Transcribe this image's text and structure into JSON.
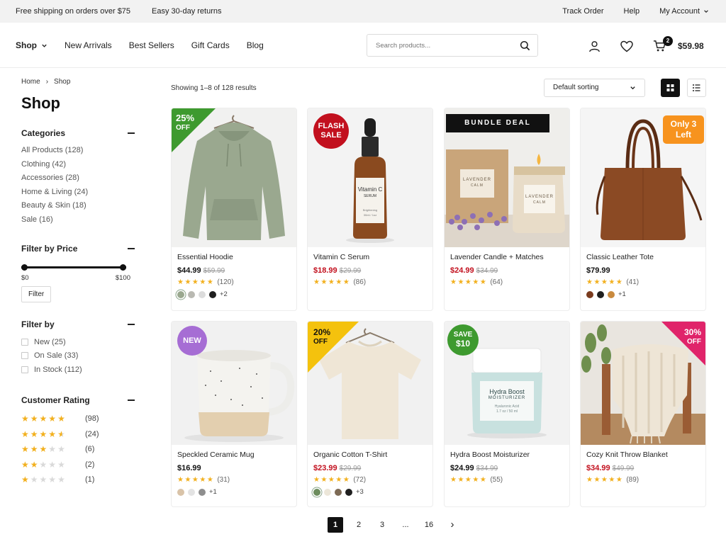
{
  "topbar": {
    "promo1": "Free shipping on orders over $75",
    "promo2": "Easy 30-day returns",
    "track": "Track Order",
    "help": "Help",
    "account": "My Account"
  },
  "nav": {
    "shop": "Shop",
    "items": [
      "New Arrivals",
      "Best Sellers",
      "Gift Cards",
      "Blog"
    ]
  },
  "search": {
    "placeholder": "Search products..."
  },
  "cart": {
    "count": "2",
    "total": "$59.98"
  },
  "breadcrumb": {
    "home": "Home",
    "sep": "›",
    "current": "Shop"
  },
  "page_title": "Shop",
  "categories": {
    "title": "Categories",
    "items": [
      "All Products (128)",
      "Clothing (42)",
      "Accessories (28)",
      "Home & Living (24)",
      "Beauty & Skin (18)",
      "Sale (16)"
    ]
  },
  "price_filter": {
    "title": "Filter by Price",
    "min": "$0",
    "max": "$100",
    "button": "Filter",
    "low_fraction": 0,
    "high_fraction": 1
  },
  "filter_by": {
    "title": "Filter by",
    "items": [
      "New (25)",
      "On Sale (33)",
      "In Stock (112)"
    ]
  },
  "customer_rating": {
    "title": "Customer Rating",
    "rows": [
      {
        "stars": 5,
        "count": "(98)"
      },
      {
        "stars": 4.5,
        "count": "(24)"
      },
      {
        "stars": 3,
        "count": "(6)"
      },
      {
        "stars": 2,
        "count": "(2)"
      },
      {
        "stars": 1,
        "count": "(1)"
      }
    ]
  },
  "toolbar": {
    "showing": "Showing 1–8 of 128 results",
    "sort": "Default sorting"
  },
  "products": [
    {
      "name": "Essential Hoodie",
      "price": "$44.99",
      "old": "$59.99",
      "sale": false,
      "reviews": "(120)",
      "badge": [
        "25%",
        "OFF"
      ],
      "swatches": [
        "#9aa88f",
        "#b9b9b2",
        "#dcdcdc",
        "#1f1f1f"
      ],
      "more": "+2"
    },
    {
      "name": "Vitamin C Serum",
      "price": "$18.99",
      "old": "$29.99",
      "sale": true,
      "reviews": "(86)",
      "badge": [
        "FLASH",
        "SALE"
      ],
      "swatches": [],
      "more": ""
    },
    {
      "name": "Lavender Candle + Matches",
      "price": "$24.99",
      "old": "$34.99",
      "sale": true,
      "reviews": "(64)",
      "badge": [
        "BUNDLE DEAL"
      ],
      "swatches": [],
      "more": ""
    },
    {
      "name": "Classic Leather Tote",
      "price": "$79.99",
      "old": "",
      "sale": false,
      "reviews": "(41)",
      "badge": [
        "Only 3",
        "Left"
      ],
      "swatches": [
        "#7a3b1e",
        "#1f1f1f",
        "#c98a3e"
      ],
      "more": "+1"
    },
    {
      "name": "Speckled Ceramic Mug",
      "price": "$16.99",
      "old": "",
      "sale": false,
      "reviews": "(31)",
      "badge": [
        "NEW"
      ],
      "swatches": [
        "#d9c3a8",
        "#e3e3e3",
        "#8e8e8e"
      ],
      "more": "+1"
    },
    {
      "name": "Organic Cotton T-Shirt",
      "price": "$23.99",
      "old": "$29.99",
      "sale": true,
      "reviews": "(72)",
      "badge": [
        "20%",
        "OFF"
      ],
      "swatches": [
        "#6d8d5e",
        "#ece6d9",
        "#7d6a55",
        "#1f1f1f"
      ],
      "more": "+3"
    },
    {
      "name": "Hydra Boost Moisturizer",
      "price": "$24.99",
      "old": "$34.99",
      "sale": false,
      "reviews": "(55)",
      "badge": [
        "SAVE",
        "$10"
      ],
      "swatches": [],
      "more": ""
    },
    {
      "name": "Cozy Knit Throw Blanket",
      "price": "$34.99",
      "old": "$49.99",
      "sale": true,
      "reviews": "(89)",
      "badge": [
        "30%",
        "OFF"
      ],
      "swatches": [],
      "more": ""
    }
  ],
  "product_images": {
    "serum_label": [
      "Vitamin C",
      "SERUM",
      "Brightening",
      "30ml / 1oz"
    ],
    "candle_label": [
      "LAVENDER",
      "CALM"
    ],
    "jar_label": [
      "Hydra Boost",
      "MOISTURIZER",
      "Hyaluronic Acid",
      "1.7 oz / 50 ml"
    ]
  },
  "pagination": {
    "pages": [
      "1",
      "2",
      "3",
      "...",
      "16"
    ],
    "next": "›"
  },
  "colors": {
    "sale_red": "#c2101e",
    "star": "#f2b01e",
    "green_badge": "#3e9a2f",
    "yellow_badge": "#f4c20d",
    "pink_badge": "#e0246a",
    "purple_badge": "#a66dd4",
    "orange_badge": "#f7931e"
  }
}
